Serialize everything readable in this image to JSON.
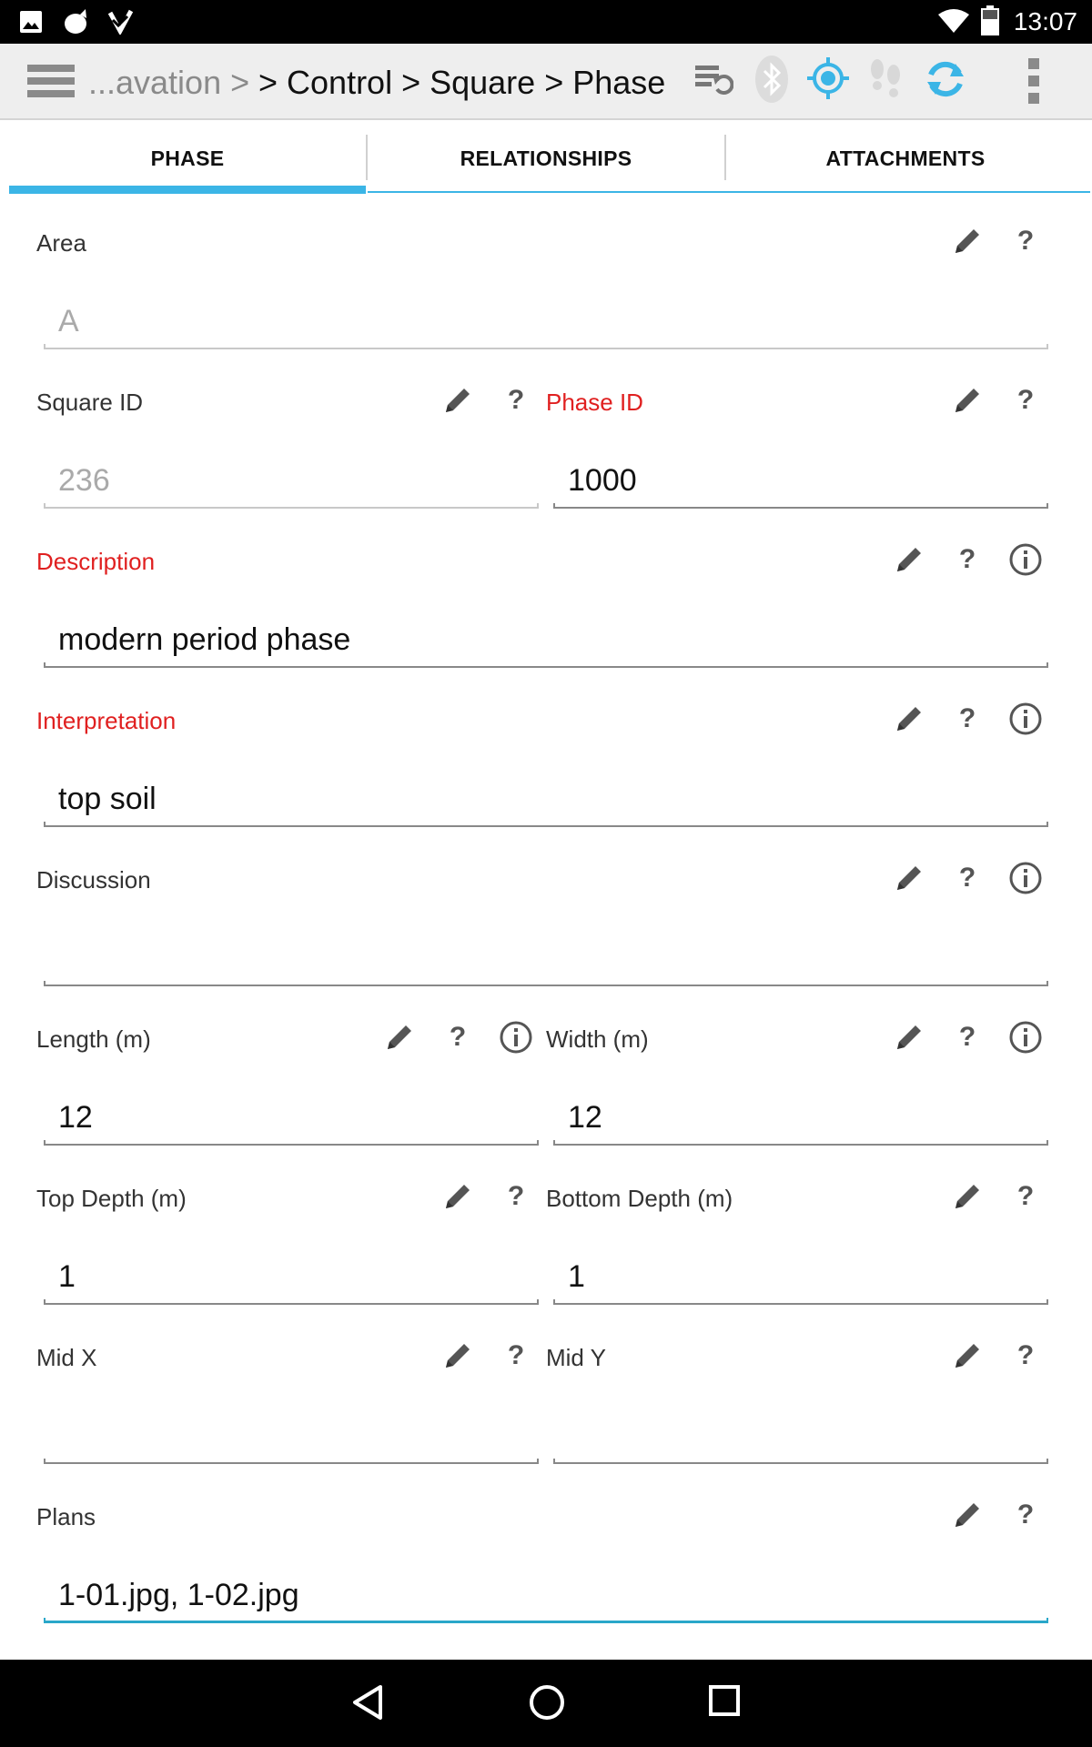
{
  "status_bar": {
    "time": "13:07",
    "left_icons": [
      "image-icon",
      "cat-icon",
      "download-check-icon"
    ],
    "right_icons": [
      "wifi-icon",
      "battery-icon"
    ]
  },
  "action_bar": {
    "breadcrumb_truncated": "...avation >",
    "breadcrumb_current": "> Control > Square > Phase",
    "icons": [
      "menu-icon",
      "sync-settings-icon",
      "bluetooth-icon",
      "gps-icon",
      "tracking-footsteps-icon",
      "sync-icon",
      "overflow-menu-icon"
    ]
  },
  "tabs": [
    {
      "label": "PHASE",
      "active": true
    },
    {
      "label": "RELATIONSHIPS",
      "active": false
    },
    {
      "label": "ATTACHMENTS",
      "active": false
    }
  ],
  "fields": {
    "area": {
      "label": "Area",
      "value": "A",
      "required": false
    },
    "square_id": {
      "label": "Square ID",
      "value": "236",
      "required": false
    },
    "phase_id": {
      "label": "Phase ID",
      "value": "1000",
      "required": true
    },
    "description": {
      "label": "Description",
      "value": "modern period phase",
      "required": true
    },
    "interpretation": {
      "label": "Interpretation",
      "value": "top soil",
      "required": true
    },
    "discussion": {
      "label": "Discussion",
      "value": "",
      "required": false
    },
    "length": {
      "label": "Length (m)",
      "value": "12",
      "required": false
    },
    "width": {
      "label": "Width (m)",
      "value": "12",
      "required": false
    },
    "top_depth": {
      "label": "Top Depth (m)",
      "value": "1",
      "required": false
    },
    "bottom_depth": {
      "label": "Bottom Depth (m)",
      "value": "1",
      "required": false
    },
    "mid_x": {
      "label": "Mid X",
      "value": "",
      "required": false
    },
    "mid_y": {
      "label": "Mid Y",
      "value": "",
      "required": false
    },
    "plans": {
      "label": "Plans",
      "value": "1-01.jpg, 1-02.jpg",
      "required": false
    }
  },
  "field_icons": {
    "edit": "pencil-icon",
    "help": "?",
    "info": "info-icon"
  },
  "colors": {
    "accent": "#3bb5e6",
    "required_label": "#e02020",
    "focus_underline": "#2aa7c9"
  },
  "nav_bar": {
    "icons": [
      "back-icon",
      "home-icon",
      "recents-icon"
    ]
  }
}
